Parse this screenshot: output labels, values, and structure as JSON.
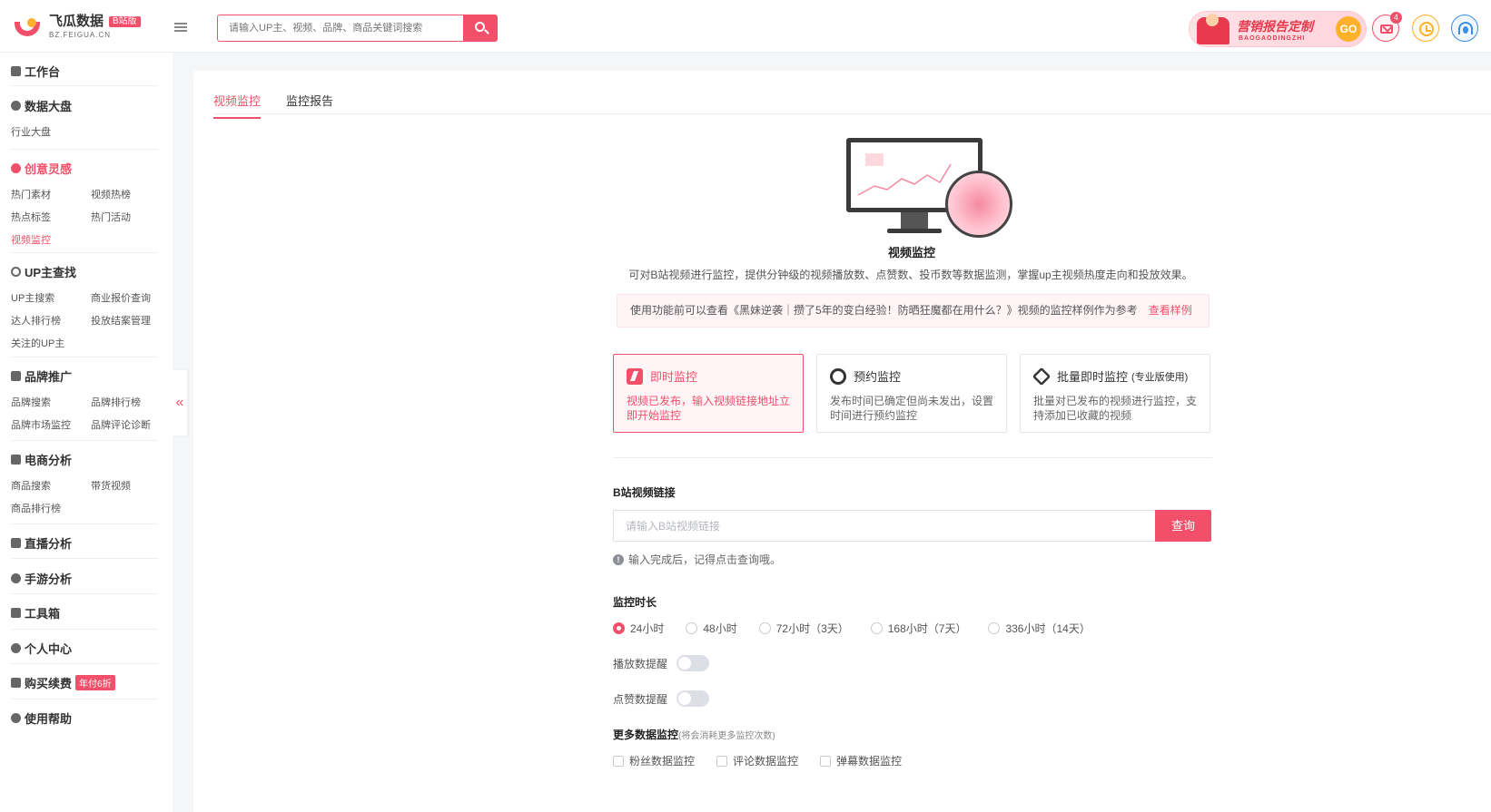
{
  "header": {
    "logo_name": "飞瓜数据",
    "logo_badge": "B站版",
    "logo_domain": "BZ.FEIGUA.CN",
    "search_placeholder": "请输入UP主、视频、品牌、商品关键词搜索",
    "promo_title": "营销报告定制",
    "promo_sub": "BAOGAODINGZHI",
    "promo_go": "GO",
    "mail_count": "4",
    "accent_color": "#f2506a"
  },
  "sidebar": {
    "workbench": "工作台",
    "dashboard": {
      "title": "数据大盘",
      "items": [
        "行业大盘"
      ]
    },
    "creative": {
      "title": "创意灵感",
      "items": [
        "热门素材",
        "视频热榜",
        "热点标签",
        "热门活动",
        "视频监控"
      ],
      "active": "视频监控"
    },
    "up_search": {
      "title": "UP主查找",
      "items": [
        "UP主搜索",
        "商业报价查询",
        "达人排行榜",
        "投放结案管理",
        "关注的UP主"
      ]
    },
    "brand": {
      "title": "品牌推广",
      "items": [
        "品牌搜索",
        "品牌排行榜",
        "品牌市场监控",
        "品牌评论诊断"
      ]
    },
    "ecommerce": {
      "title": "电商分析",
      "items": [
        "商品搜索",
        "带货视频",
        "商品排行榜"
      ]
    },
    "live": "直播分析",
    "mobile_game": "手游分析",
    "toolbox": "工具箱",
    "personal": "个人中心",
    "purchase": "购买续费",
    "purchase_tag": "年付6折",
    "help": "使用帮助",
    "collapse": "«"
  },
  "main": {
    "tabs": [
      "视频监控",
      "监控报告"
    ],
    "active_tab": "视频监控",
    "feature_title": "视频监控",
    "feature_desc": "可对B站视频进行监控，提供分钟级的视频播放数、点赞数、投币数等数据监测，掌握up主视频热度走向和投放效果。",
    "notice_text": "使用功能前可以查看《黑妹逆袭｜攒了5年的变白经验！防晒狂魔都在用什么？》视频的监控样例作为参考",
    "notice_link": "查看样例",
    "modes": [
      {
        "title": "即时监控",
        "note": "",
        "desc": "视频已发布，输入视频链接地址立即开始监控",
        "icon": "bolt-icon",
        "active": true
      },
      {
        "title": "预约监控",
        "note": "",
        "desc": "发布时间已确定但尚未发出，设置时间进行预约监控",
        "icon": "alarm-clock-icon",
        "active": false
      },
      {
        "title": "批量即时监控",
        "note": "(专业版使用)",
        "desc": "批量对已发布的视频进行监控，支持添加已收藏的视频",
        "icon": "layers-icon",
        "active": false
      }
    ],
    "link_label": "B站视频链接",
    "link_placeholder": "请输入B站视频链接",
    "query_button": "查询",
    "hint": "输入完成后，记得点击查询哦。",
    "duration_label": "监控时长",
    "durations": [
      "24小时",
      "48小时",
      "72小时（3天）",
      "168小时（7天）",
      "336小时（14天）"
    ],
    "selected_duration": "24小时",
    "play_alert": "播放数提醒",
    "like_alert": "点赞数提醒",
    "play_alert_on": false,
    "like_alert_on": false,
    "more_label": "更多数据监控",
    "more_note": "(将会消耗更多监控次数)",
    "more_options": [
      "粉丝数据监控",
      "评论数据监控",
      "弹幕数据监控"
    ]
  }
}
